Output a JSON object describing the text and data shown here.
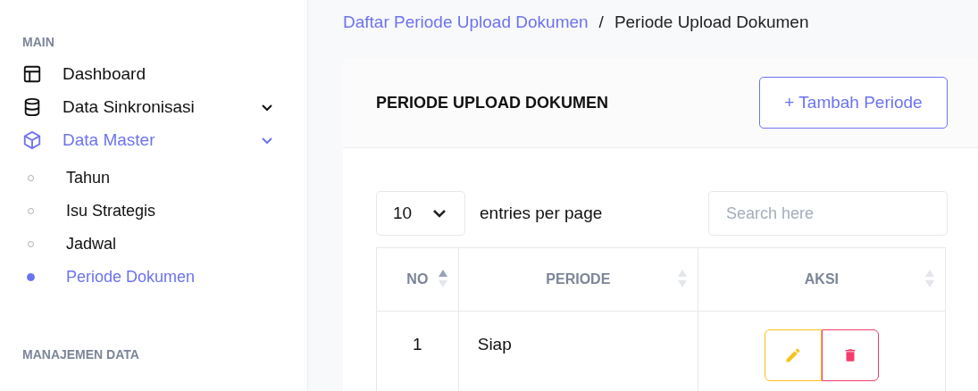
{
  "sidebar": {
    "sections": [
      {
        "heading": "MAIN",
        "items": [
          {
            "label": "Dashboard",
            "selected": false,
            "expandable": false
          },
          {
            "label": "Data Sinkronisasi",
            "selected": false,
            "expandable": true
          },
          {
            "label": "Data Master",
            "selected": true,
            "expandable": true,
            "children": [
              {
                "label": "Tahun",
                "selected": false
              },
              {
                "label": "Isu Strategis",
                "selected": false
              },
              {
                "label": "Jadwal",
                "selected": false
              },
              {
                "label": "Periode Dokumen",
                "selected": true
              }
            ]
          }
        ]
      },
      {
        "heading": "MANAJEMEN DATA"
      }
    ]
  },
  "breadcrumb": {
    "link": "Daftar Periode Upload Dokumen",
    "separator": "/",
    "current": "Periode Upload Dokumen"
  },
  "card": {
    "title": "PERIODE UPLOAD DOKUMEN",
    "add_button": "+ Tambah Periode",
    "page_size": "10",
    "page_size_label": "entries per page",
    "search": {
      "placeholder": "Search here"
    },
    "table": {
      "columns": [
        {
          "label": "NO",
          "sorted": true
        },
        {
          "label": "PERIODE",
          "sorted": false
        },
        {
          "label": "AKSI",
          "sorted": false
        }
      ],
      "rows": [
        {
          "no": "1",
          "periode": "Siap"
        }
      ]
    }
  }
}
